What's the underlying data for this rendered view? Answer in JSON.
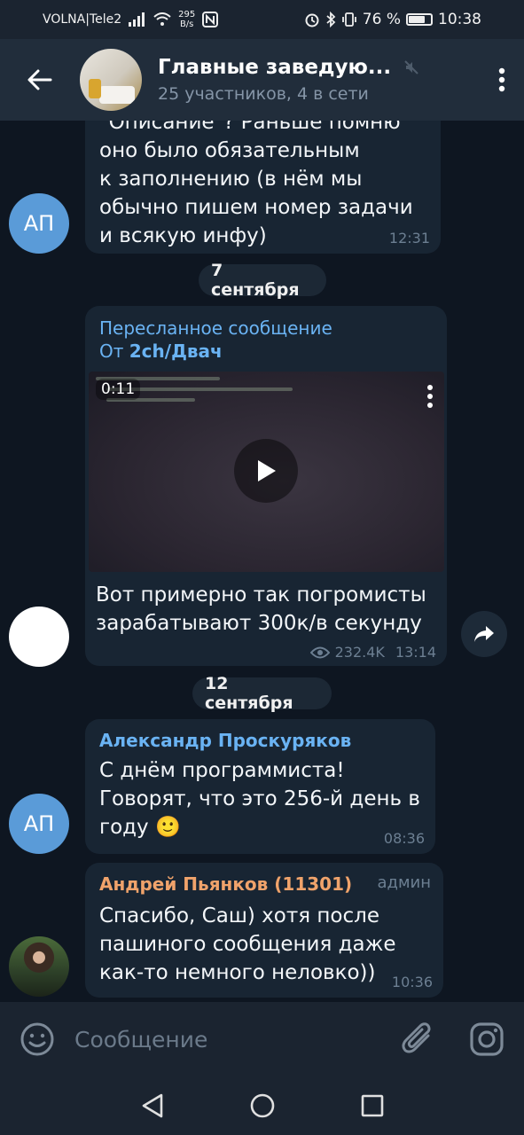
{
  "status_bar": {
    "carrier": "VOLNA|Tele2",
    "net_speed_value": "295",
    "net_speed_unit": "B/s",
    "battery_percent": "76 %",
    "battery_level": 0.76,
    "time": "10:38"
  },
  "header": {
    "title": "Главные заведую...",
    "subtitle": "25 участников, 4 в сети",
    "icons": [
      "back-arrow-icon",
      "mute-icon",
      "more-vert-icon"
    ]
  },
  "messages": [
    {
      "text_lines": [
        "\"Описание\"? Раньше помню",
        "оно было обязательным",
        "к заполнению (в нём мы",
        "обычно пишем номер задачи",
        "и всякую инфу)"
      ],
      "time": "12:31",
      "avatar_initials": "АП"
    },
    {
      "date_separator": "7 сентября"
    },
    {
      "forward_label": "Пересланное сообщение",
      "forward_from_prefix": "От ",
      "forward_from": "2ch/Двач",
      "video_duration": "0:11",
      "text_lines": [
        "Вот примерно так погромисты",
        "зарабатывают 300к/в секунду"
      ],
      "views": "232.4K",
      "time": "13:14"
    },
    {
      "date_separator": "12 сентября"
    },
    {
      "sender": "Александр Проскуряков",
      "text_lines": [
        "С днём программиста!",
        "Говорят, что это 256-й день в",
        "году"
      ],
      "emoji": "🙂",
      "time": "08:36",
      "avatar_initials": "АП"
    },
    {
      "sender": "Андрей Пьянков (11301)",
      "role": "админ",
      "text_lines": [
        "Спасибо, Саш) хотя после",
        "пашиного сообщения даже",
        "как-то немного неловко))"
      ],
      "time": "10:36"
    }
  ],
  "input": {
    "placeholder": "Сообщение"
  },
  "colors": {
    "background": "#0e1621",
    "bubble": "#182533",
    "header": "#212d3b",
    "accent_link": "#6ab3f3",
    "sender_blue": "#6ab3f3",
    "sender_orange": "#f0a36b",
    "avatar_blue": "#5a9bd8"
  }
}
